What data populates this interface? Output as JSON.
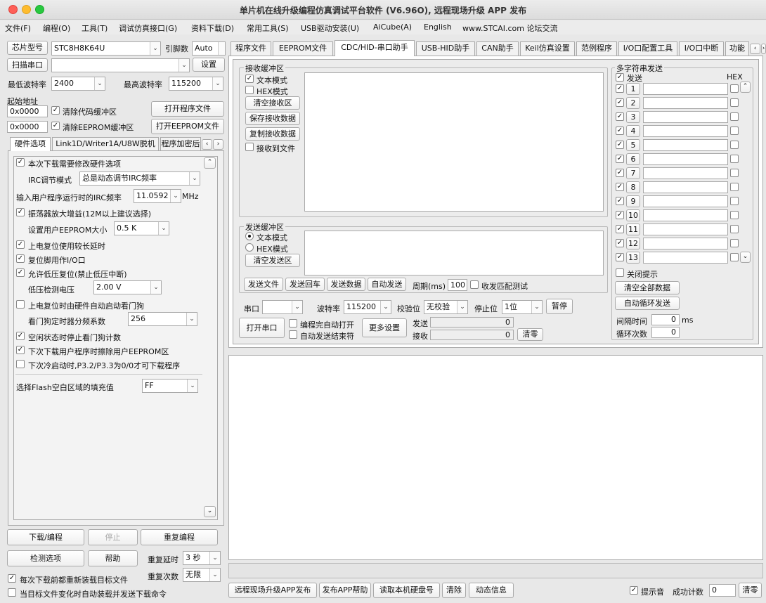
{
  "window": {
    "title": "单片机在线升级编程仿真调试平台软件 (V6.96O), 远程现场升级 APP 发布"
  },
  "menu": [
    "文件(F)",
    "编程(O)",
    "工具(T)",
    "调试仿真接口(G)",
    "资料下载(D)",
    "常用工具(S)",
    "USB驱动安装(U)",
    "AiCube(A)",
    "English",
    "www.STCAI.com 论坛交流"
  ],
  "left": {
    "chip_label": "芯片型号",
    "chip_value": "STC8H8K64U",
    "pins_label": "引脚数",
    "pins_value": "Auto",
    "scan_label": "扫描串口",
    "port_value": "",
    "settings_label": "设置",
    "min_baud_label": "最低波特率",
    "min_baud_value": "2400",
    "max_baud_label": "最高波特率",
    "max_baud_value": "115200",
    "start_addr_label": "起始地址",
    "addr1_prefix": "0x",
    "addr1_value": "0000",
    "clear_code_label": "清除代码缓冲区",
    "open_prog_label": "打开程序文件",
    "addr2_prefix": "0x",
    "addr2_value": "0000",
    "clear_eeprom_label": "清除EEPROM缓冲区",
    "open_eeprom_label": "打开EEPROM文件",
    "tabs": [
      "硬件选项",
      "Link1D/Writer1A/U8W脱机",
      "程序加密后"
    ],
    "hw": {
      "modify": "本次下载需要修改硬件选项",
      "irc_mode_label": "IRC调节模式",
      "irc_mode_value": "总是动态调节IRC频率",
      "irc_freq_label": "输入用户程序运行时的IRC频率",
      "irc_freq_value": "11.0592",
      "irc_unit": "MHz",
      "osc": "振荡器放大增益(12M以上建议选择)",
      "eeprom_size_label": "设置用户EEPROM大小",
      "eeprom_size_value": "0.5 K",
      "long_delay": "上电复位使用较长延时",
      "reset_io": "复位脚用作I/O口",
      "lvr": "允许低压复位(禁止低压中断)",
      "lv_label": "低压检测电压",
      "lv_value": "2.00 V",
      "wdt_auto": "上电复位时由硬件自动启动看门狗",
      "wdt_div_label": "看门狗定时器分频系数",
      "wdt_div_value": "256",
      "idle_wdt": "空闲状态时停止看门狗计数",
      "erase_eeprom": "下次下载用户程序时擦除用户EEPROM区",
      "p32": "下次冷启动时,P3.2/P3.3为0/0才可下载程序",
      "fill_label": "选择Flash空白区域的填充值",
      "fill_value": "FF"
    },
    "download_label": "下载/编程",
    "stop_label": "停止",
    "repeat_prog_label": "重复编程",
    "check_label": "检测选项",
    "help_label": "帮助",
    "repeat_delay_label": "重复延时",
    "repeat_delay_value": "3 秒",
    "repeat_count_label": "重复次数",
    "repeat_count_value": "无限",
    "reload_label": "每次下载前都重新装载目标文件",
    "auto_reload_label": "当目标文件变化时自动装载并发送下载命令"
  },
  "right_tabs": [
    "程序文件",
    "EEPROM文件",
    "CDC/HID-串口助手",
    "USB-HID助手",
    "CAN助手",
    "Keil仿真设置",
    "范例程序",
    "I/O口配置工具",
    "I/O口中断",
    "功能"
  ],
  "serial": {
    "recv_title": "接收缓冲区",
    "text_mode": "文本模式",
    "hex_mode": "HEX模式",
    "clear_recv": "清空接收区",
    "save_recv": "保存接收数据",
    "copy_recv": "复制接收数据",
    "recv_to_file": "接收到文件",
    "send_title": "发送缓冲区",
    "send_text_mode": "文本模式",
    "send_hex_mode": "HEX模式",
    "clear_send": "清空发送区",
    "send_file": "发送文件",
    "send_cr": "发送回车",
    "send_data": "发送数据",
    "auto_send": "自动发送",
    "period_label": "周期(ms)",
    "period_value": "100",
    "match_test": "收发匹配测试",
    "port_label": "串口",
    "port_value": "",
    "baud_label": "波特率",
    "baud_value": "115200",
    "parity_label": "校验位",
    "parity_value": "无校验",
    "stop_label": "停止位",
    "stop_value": "1位",
    "pause": "暂停",
    "open_port": "打开串口",
    "auto_open": "编程完自动打开",
    "auto_end": "自动发送结束符",
    "more": "更多设置",
    "send_label": "发送",
    "send_count": "0",
    "recv_label": "接收",
    "recv_count": "0",
    "clear_count": "清零"
  },
  "multi": {
    "title": "多字符串发送",
    "send_header": "发送",
    "hex_header": "HEX",
    "rows": [
      "1",
      "2",
      "3",
      "4",
      "5",
      "6",
      "7",
      "8",
      "9",
      "10",
      "11",
      "12",
      "13"
    ],
    "close_tip": "关闭提示",
    "clear_all": "清空全部数据",
    "auto_loop": "自动循环发送",
    "interval_label": "间隔时间",
    "interval_value": "0",
    "interval_unit": "ms",
    "loop_label": "循环次数",
    "loop_value": "0"
  },
  "bottom": {
    "remote_app": "远程现场升级APP发布",
    "publish_help": "发布APP帮助",
    "read_disk": "读取本机硬盘号",
    "clear": "清除",
    "dyn_info": "动态信息",
    "tip_sound": "提示音",
    "success_label": "成功计数",
    "success_value": "0",
    "clear_success": "清零"
  }
}
